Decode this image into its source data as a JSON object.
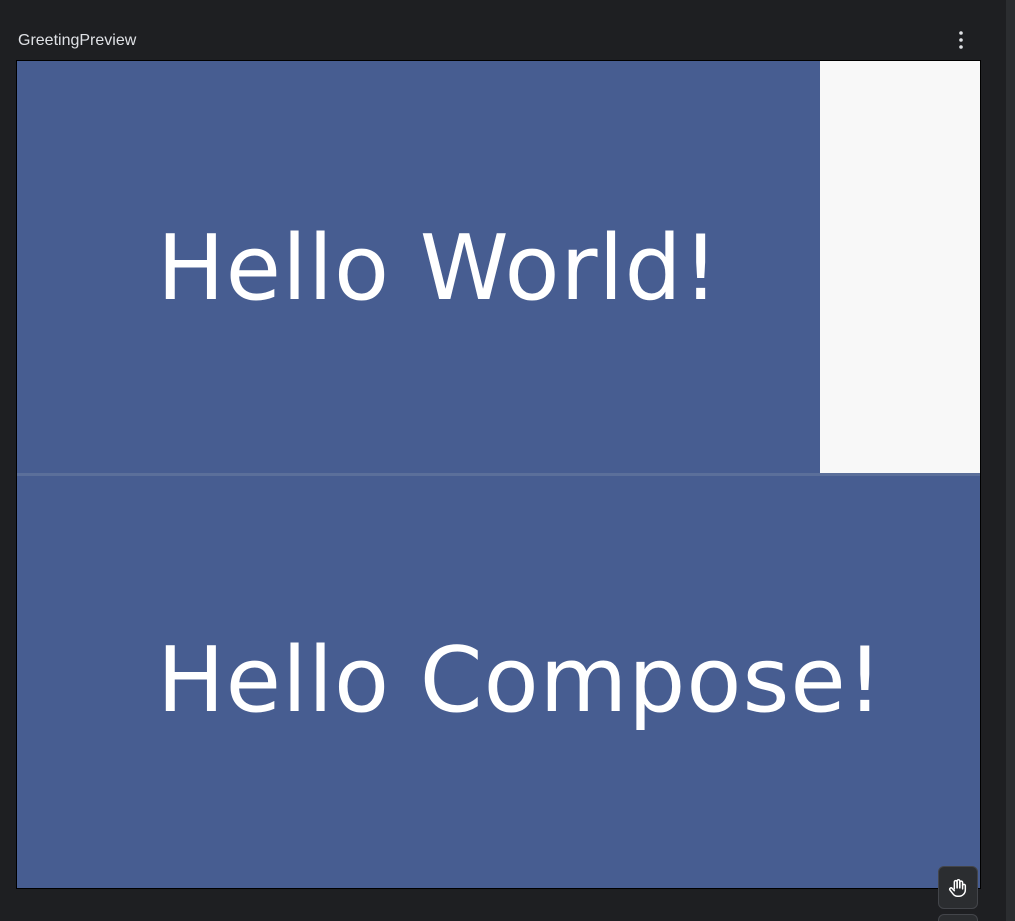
{
  "preview": {
    "title": "GreetingPreview",
    "menu_icon": "more-vertical-icon"
  },
  "greetings": [
    {
      "text": "Hello World!",
      "background": "#475d91"
    },
    {
      "text": "Hello Compose!",
      "background": "#475d91"
    }
  ],
  "colors": {
    "ide_background": "#1e1f22",
    "surface_background": "#f8f8f8",
    "divider": "#5b6f9a",
    "greeting_text": "#ffffff"
  },
  "toolbar": {
    "pan_tool_icon": "hand-icon"
  }
}
